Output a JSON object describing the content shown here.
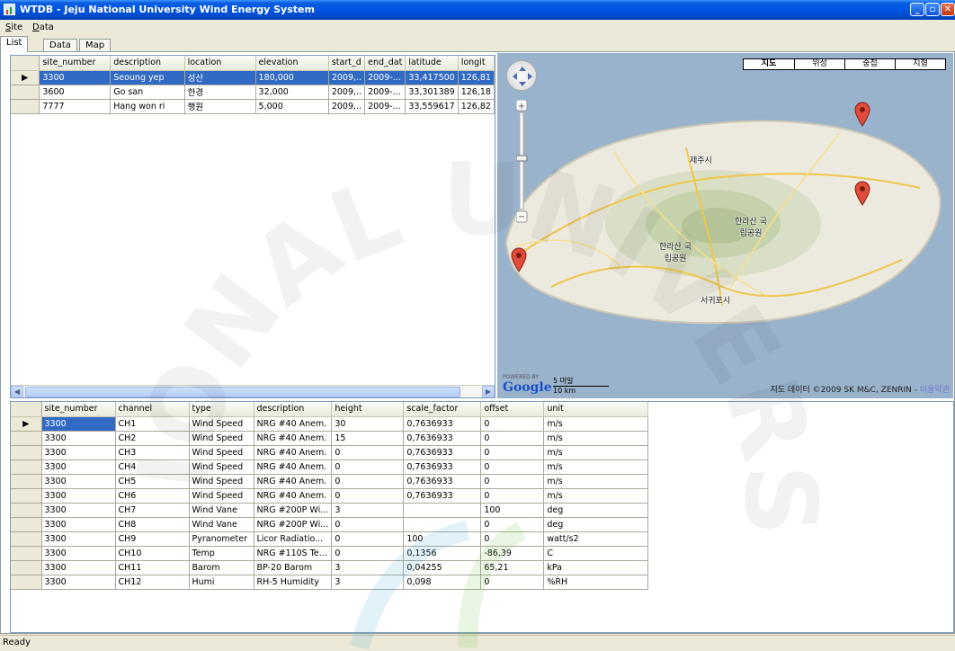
{
  "window": {
    "title": "WTDB - Jeju National University Wind Energy System"
  },
  "menu": {
    "items": [
      {
        "key": "S",
        "rest": "ite"
      },
      {
        "key": "D",
        "rest": "ata"
      }
    ]
  },
  "tabs": [
    "List",
    "Data",
    "Map"
  ],
  "sites": {
    "columns": [
      "site_number",
      "description",
      "location",
      "elevation",
      "start_d",
      "end_dat",
      "latitude",
      "longit"
    ],
    "rows": [
      [
        "3300",
        "Seoung yep",
        "성산",
        "180,000",
        "2009,..",
        "2009-...",
        "33,417500",
        "126,81"
      ],
      [
        "3600",
        "Go san",
        "한경",
        "32,000",
        "2009,..",
        "2009-...",
        "33,301389",
        "126,18"
      ],
      [
        "7777",
        "Hang won ri",
        "행원",
        "5,000",
        "2009,..",
        "2009-...",
        "33,559617",
        "126,82"
      ]
    ]
  },
  "map": {
    "types": [
      "지도",
      "위성",
      "중첩",
      "지형"
    ],
    "labels": [
      "제주시",
      "한라산 국립공원",
      "한라산 국립공원",
      "서귀포시"
    ],
    "powered_by": "POWERED BY",
    "logo": "Google",
    "scale_top": "5 마일",
    "scale_bottom": "10 km",
    "copyright": "지도 데이터 ©2009 SK M&C, ZENRIN -",
    "terms_link": "이용약관"
  },
  "channels": {
    "columns": [
      "site_number",
      "channel",
      "type",
      "description",
      "height",
      "scale_factor",
      "offset",
      "unit"
    ],
    "rows": [
      [
        "3300",
        "CH1",
        "Wind Speed",
        "NRG #40 Anem.",
        "30",
        "0,7636933",
        "0",
        "m/s"
      ],
      [
        "3300",
        "CH2",
        "Wind Speed",
        "NRG #40 Anem.",
        "15",
        "0,7636933",
        "0",
        "m/s"
      ],
      [
        "3300",
        "CH3",
        "Wind  Speed",
        "NRG #40 Anem.",
        "0",
        "0,7636933",
        "0",
        "m/s"
      ],
      [
        "3300",
        "CH4",
        "Wind Speed",
        "NRG #40 Anem.",
        "0",
        "0,7636933",
        "0",
        "m/s"
      ],
      [
        "3300",
        "CH5",
        "Wind Speed",
        "NRG #40 Anem.",
        "0",
        "0,7636933",
        "0",
        "m/s"
      ],
      [
        "3300",
        "CH6",
        "Wind Speed",
        "NRG #40 Anem.",
        "0",
        "0,7636933",
        "0",
        "m/s"
      ],
      [
        "3300",
        "CH7",
        "Wind Vane",
        "NRG #200P Wi...",
        "3",
        "",
        "100",
        "deg"
      ],
      [
        "3300",
        "CH8",
        "Wind Vane",
        "NRG #200P Wi...",
        "0",
        "",
        "0",
        "deg"
      ],
      [
        "3300",
        "CH9",
        "Pyranometer",
        "Licor Radiatio...",
        "0",
        "100",
        "0",
        "watt/s2"
      ],
      [
        "3300",
        "CH10",
        "Temp",
        "NRG #110S Te...",
        "0",
        "0,1356",
        "-86,39",
        "C"
      ],
      [
        "3300",
        "CH11",
        "Barom",
        "BP-20 Barom",
        "3",
        "0,04255",
        "65,21",
        "kPa"
      ],
      [
        "3300",
        "CH12",
        "Humi",
        "RH-5 Humidity",
        "3",
        "0,098",
        "0",
        "%RH"
      ]
    ]
  },
  "status": {
    "text": "Ready"
  },
  "colors": {
    "selection": "#316ac5",
    "titlebar": "#0055e5"
  }
}
